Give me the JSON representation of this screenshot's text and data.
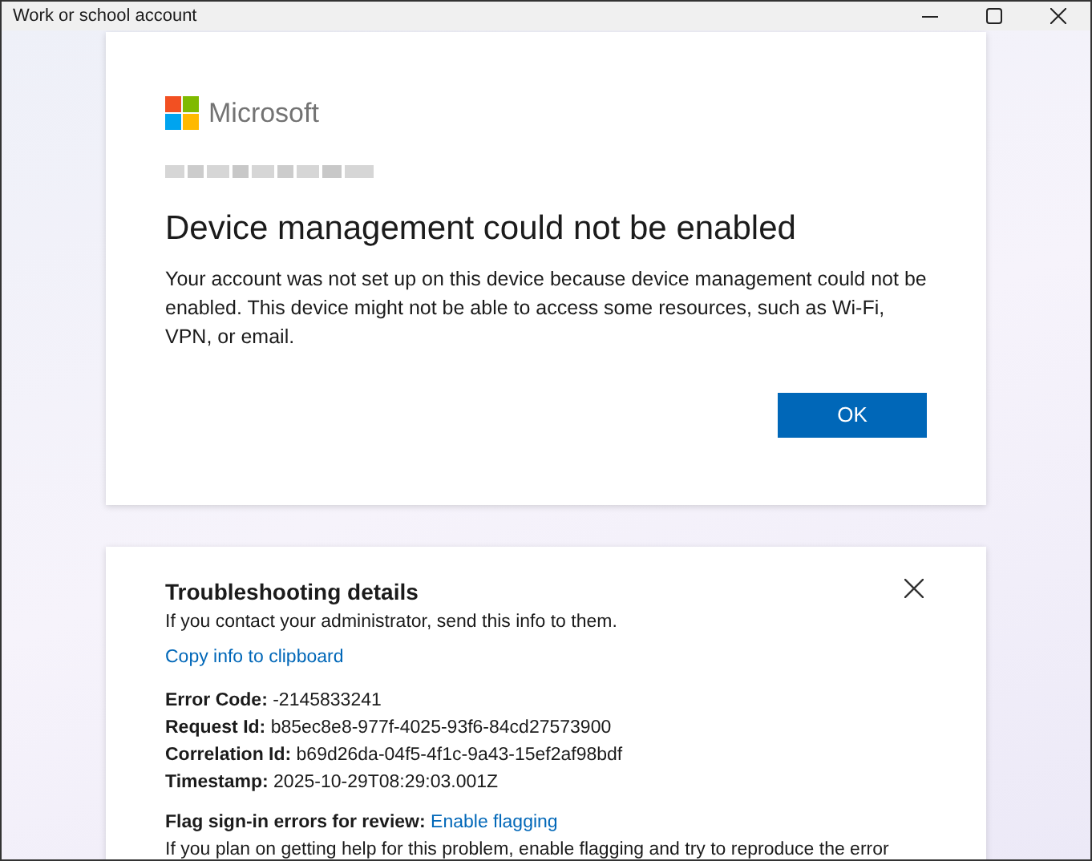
{
  "window": {
    "title": "Work or school account"
  },
  "dialog": {
    "logo_text": "Microsoft",
    "heading": "Device management could not be enabled",
    "message": "Your account was not set up on this device because device management could not be enabled. This device might not be able to access some resources, such as Wi-Fi, VPN, or email.",
    "button": "OK"
  },
  "troubleshooting": {
    "title": "Troubleshooting details",
    "intro": "If you contact your administrator, send this info to them.",
    "copy_link": "Copy info to clipboard",
    "details": [
      {
        "label": "Error Code:",
        "value": "-2145833241"
      },
      {
        "label": "Request Id:",
        "value": "b85ec8e8-977f-4025-93f6-84cd27573900"
      },
      {
        "label": "Correlation Id:",
        "value": "b69d26da-04f5-4f1c-9a43-15ef2af98bdf"
      },
      {
        "label": "Timestamp:",
        "value": "2025-10-29T08:29:03.001Z"
      }
    ],
    "flag_label": "Flag sign-in errors for review:",
    "flag_link": "Enable flagging",
    "flag_text": "If you plan on getting help for this problem, enable flagging and try to reproduce the error"
  }
}
